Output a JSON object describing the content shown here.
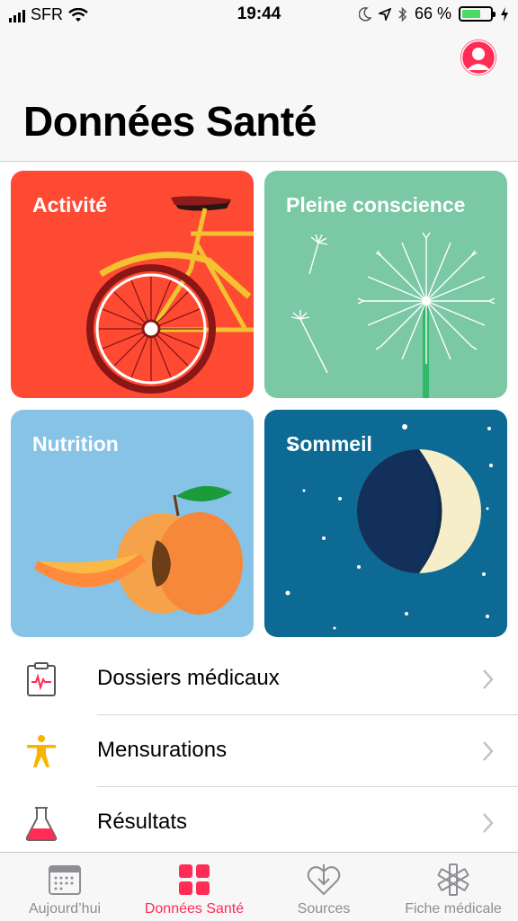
{
  "status_bar": {
    "carrier": "SFR",
    "time": "19:44",
    "battery_percent_label": "66 %",
    "battery_level": 0.66,
    "icons": [
      "signal-icon",
      "wifi-icon",
      "moon-icon",
      "location-icon",
      "bluetooth-icon",
      "battery-icon",
      "charging-icon"
    ]
  },
  "header": {
    "title": "Données Santé",
    "profile_icon": "profile-avatar-icon"
  },
  "cards": [
    {
      "label": "Activité",
      "color": "#ff4a33",
      "icon": "bicycle-illustration"
    },
    {
      "label": "Pleine conscience",
      "color": "#7ac8a4",
      "icon": "dandelion-illustration"
    },
    {
      "label": "Nutrition",
      "color": "#86c3e7",
      "icon": "peach-illustration"
    },
    {
      "label": "Sommeil",
      "color": "#0c6a94",
      "icon": "moon-illustration"
    }
  ],
  "list": [
    {
      "label": "Dossiers médicaux",
      "icon": "clipboard-icon"
    },
    {
      "label": "Mensurations",
      "icon": "body-figure-icon"
    },
    {
      "label": "Résultats",
      "icon": "flask-icon"
    }
  ],
  "tabbar": {
    "tabs": [
      {
        "label": "Aujourd’hui",
        "icon": "calendar-icon"
      },
      {
        "label": "Données Santé",
        "icon": "grid-icon"
      },
      {
        "label": "Sources",
        "icon": "heart-download-icon"
      },
      {
        "label": "Fiche médicale",
        "icon": "asterisk-icon"
      }
    ],
    "active_tab": "Données Santé",
    "accent_color": "#ff2d55"
  }
}
